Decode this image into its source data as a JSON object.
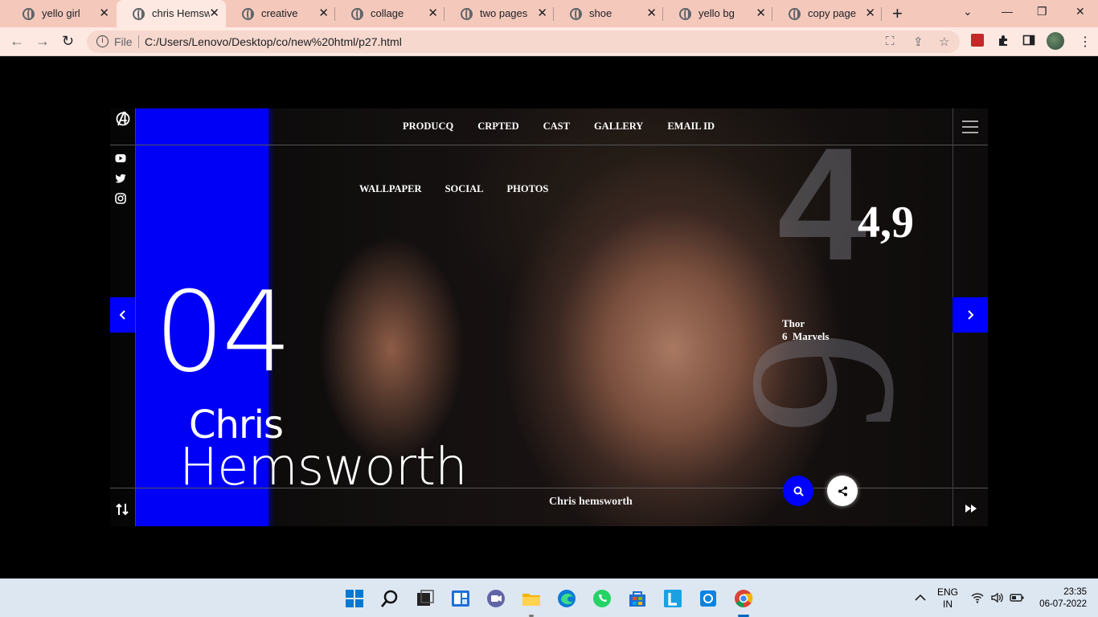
{
  "browser": {
    "tabs": [
      {
        "title": "yello girl",
        "active": false
      },
      {
        "title": "chris Hemsworth",
        "active": true
      },
      {
        "title": "creative",
        "active": false
      },
      {
        "title": "collage",
        "active": false
      },
      {
        "title": "two pages",
        "active": false
      },
      {
        "title": "shoe",
        "active": false
      },
      {
        "title": "yello bg",
        "active": false
      },
      {
        "title": "copy page",
        "active": false
      }
    ],
    "address": {
      "scheme_label": "File",
      "url": "C:/Users/Lenovo/Desktop/co/new%20html/p27.html"
    },
    "colors": {
      "tabbar": "#f4c9bc",
      "toolbar": "#fde9e2"
    }
  },
  "page": {
    "top_nav": [
      "PRODUCQ",
      "CRPTED",
      "CAST",
      "GALLERY",
      "EMAIL ID"
    ],
    "sub_nav": [
      "WALLPAPER",
      "SOCIAL",
      "PHOTOS"
    ],
    "slide_number": "04",
    "first_name": "Chris",
    "last_name": "Hemsworth",
    "rating": "4,9",
    "movie_line1": "Thor",
    "movie_line2": "6  Marvels",
    "footer_name": "Chris hemsworth",
    "accent_color": "#0000ff",
    "icons": [
      "avengers-logo-icon",
      "youtube-icon",
      "twitter-icon",
      "instagram-icon",
      "hamburger-icon",
      "chevron-left-icon",
      "chevron-right-icon",
      "search-icon",
      "share-icon",
      "sort-icon",
      "fast-forward-icon"
    ]
  },
  "taskbar": {
    "lang_line1": "ENG",
    "lang_line2": "IN",
    "time": "23:35",
    "date": "06-07-2022"
  }
}
